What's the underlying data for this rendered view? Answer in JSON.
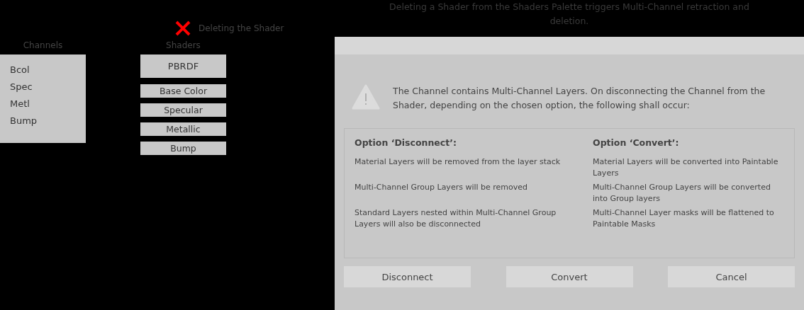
{
  "annotation": {
    "label": "Deleting the Shader"
  },
  "channels": {
    "title": "Channels",
    "items": [
      "Bcol",
      "Spec",
      "Metl",
      "Bump"
    ]
  },
  "shaders": {
    "title": "Shaders",
    "items": [
      {
        "label": "PBRDF",
        "kind": "header"
      },
      {
        "label": "Base Color",
        "kind": "channel"
      },
      {
        "label": "Specular",
        "kind": "channel"
      },
      {
        "label": "Metallic",
        "kind": "channel"
      },
      {
        "label": "Bump",
        "kind": "channel"
      }
    ]
  },
  "caption": "Deleting a Shader from the Shaders Palette triggers Multi-Channel retraction and deletion.",
  "dialog": {
    "message": "The Channel contains Multi-Channel Layers. On disconnecting the Channel from the Shader, depending on the chosen option, the following shall occur:",
    "options": [
      {
        "title": "Option ‘Disconnect’:",
        "items": [
          "Material Layers will be removed from the layer stack",
          "Multi-Channel Group Layers will be removed",
          "Standard Layers nested within Multi-Channel Group Layers will also be disconnected"
        ]
      },
      {
        "title": "Option ‘Convert’:",
        "items": [
          "Material Layers will be converted into Paintable Layers",
          "Multi-Channel Group Layers will be converted into Group layers",
          "Multi-Channel Layer masks will be flattened to Paintable Masks"
        ]
      }
    ],
    "buttons": [
      "Disconnect",
      "Convert",
      "Cancel"
    ]
  }
}
